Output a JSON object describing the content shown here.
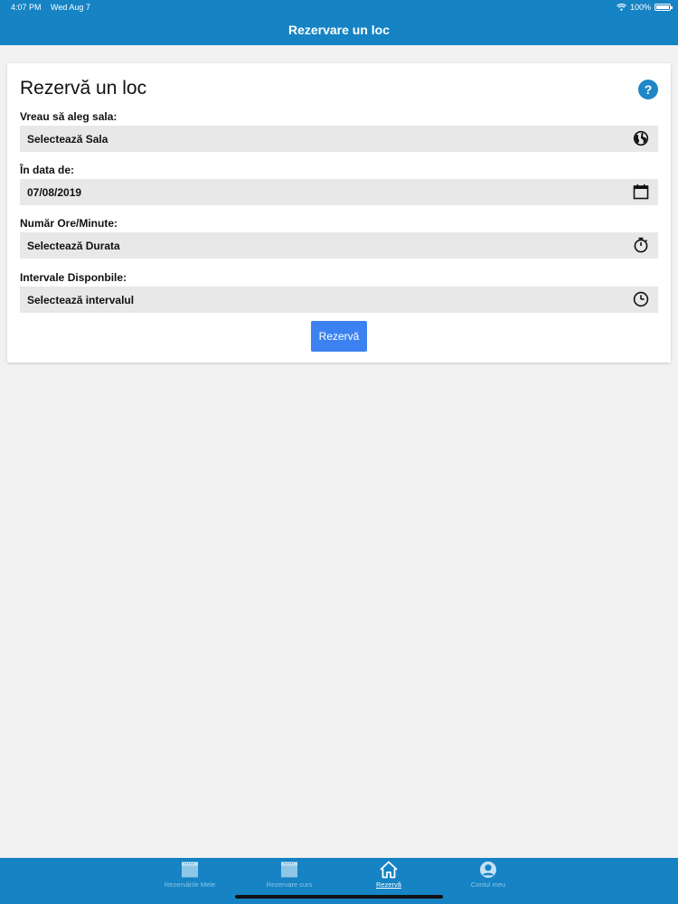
{
  "status": {
    "time": "4:07 PM",
    "date": "Wed Aug 7",
    "battery": "100%",
    "battery_level": 1.0
  },
  "nav": {
    "title": "Rezervare un loc"
  },
  "form": {
    "title": "Rezervă un loc",
    "help_label": "?",
    "fields": [
      {
        "label": "Vreau să aleg sala:",
        "value": "Selectează Sala",
        "icon": "globe-icon"
      },
      {
        "label": "În data de:",
        "value": "07/08/2019",
        "icon": "calendar-icon"
      },
      {
        "label": "Număr Ore/Minute:",
        "value": "Selectează Durata",
        "icon": "stopwatch-icon"
      },
      {
        "label": "Intervale Disponbile:",
        "value": "Selectează intervalul",
        "icon": "clock-icon"
      }
    ],
    "submit_label": "Rezervă"
  },
  "tabs": [
    {
      "label": "Rezervările Mele",
      "icon": "calendar-tab-icon",
      "active": false
    },
    {
      "label": "Rezervare curs",
      "icon": "calendar-tab-icon",
      "active": false
    },
    {
      "label": "Rezervă",
      "icon": "home-icon",
      "active": true
    },
    {
      "label": "Contul meu",
      "icon": "user-icon",
      "active": false
    }
  ],
  "colors": {
    "brand": "#1583c4",
    "button": "#3b82f0",
    "field_bg": "#e8e8e8",
    "inactive_tab": "#8fc6e6"
  }
}
